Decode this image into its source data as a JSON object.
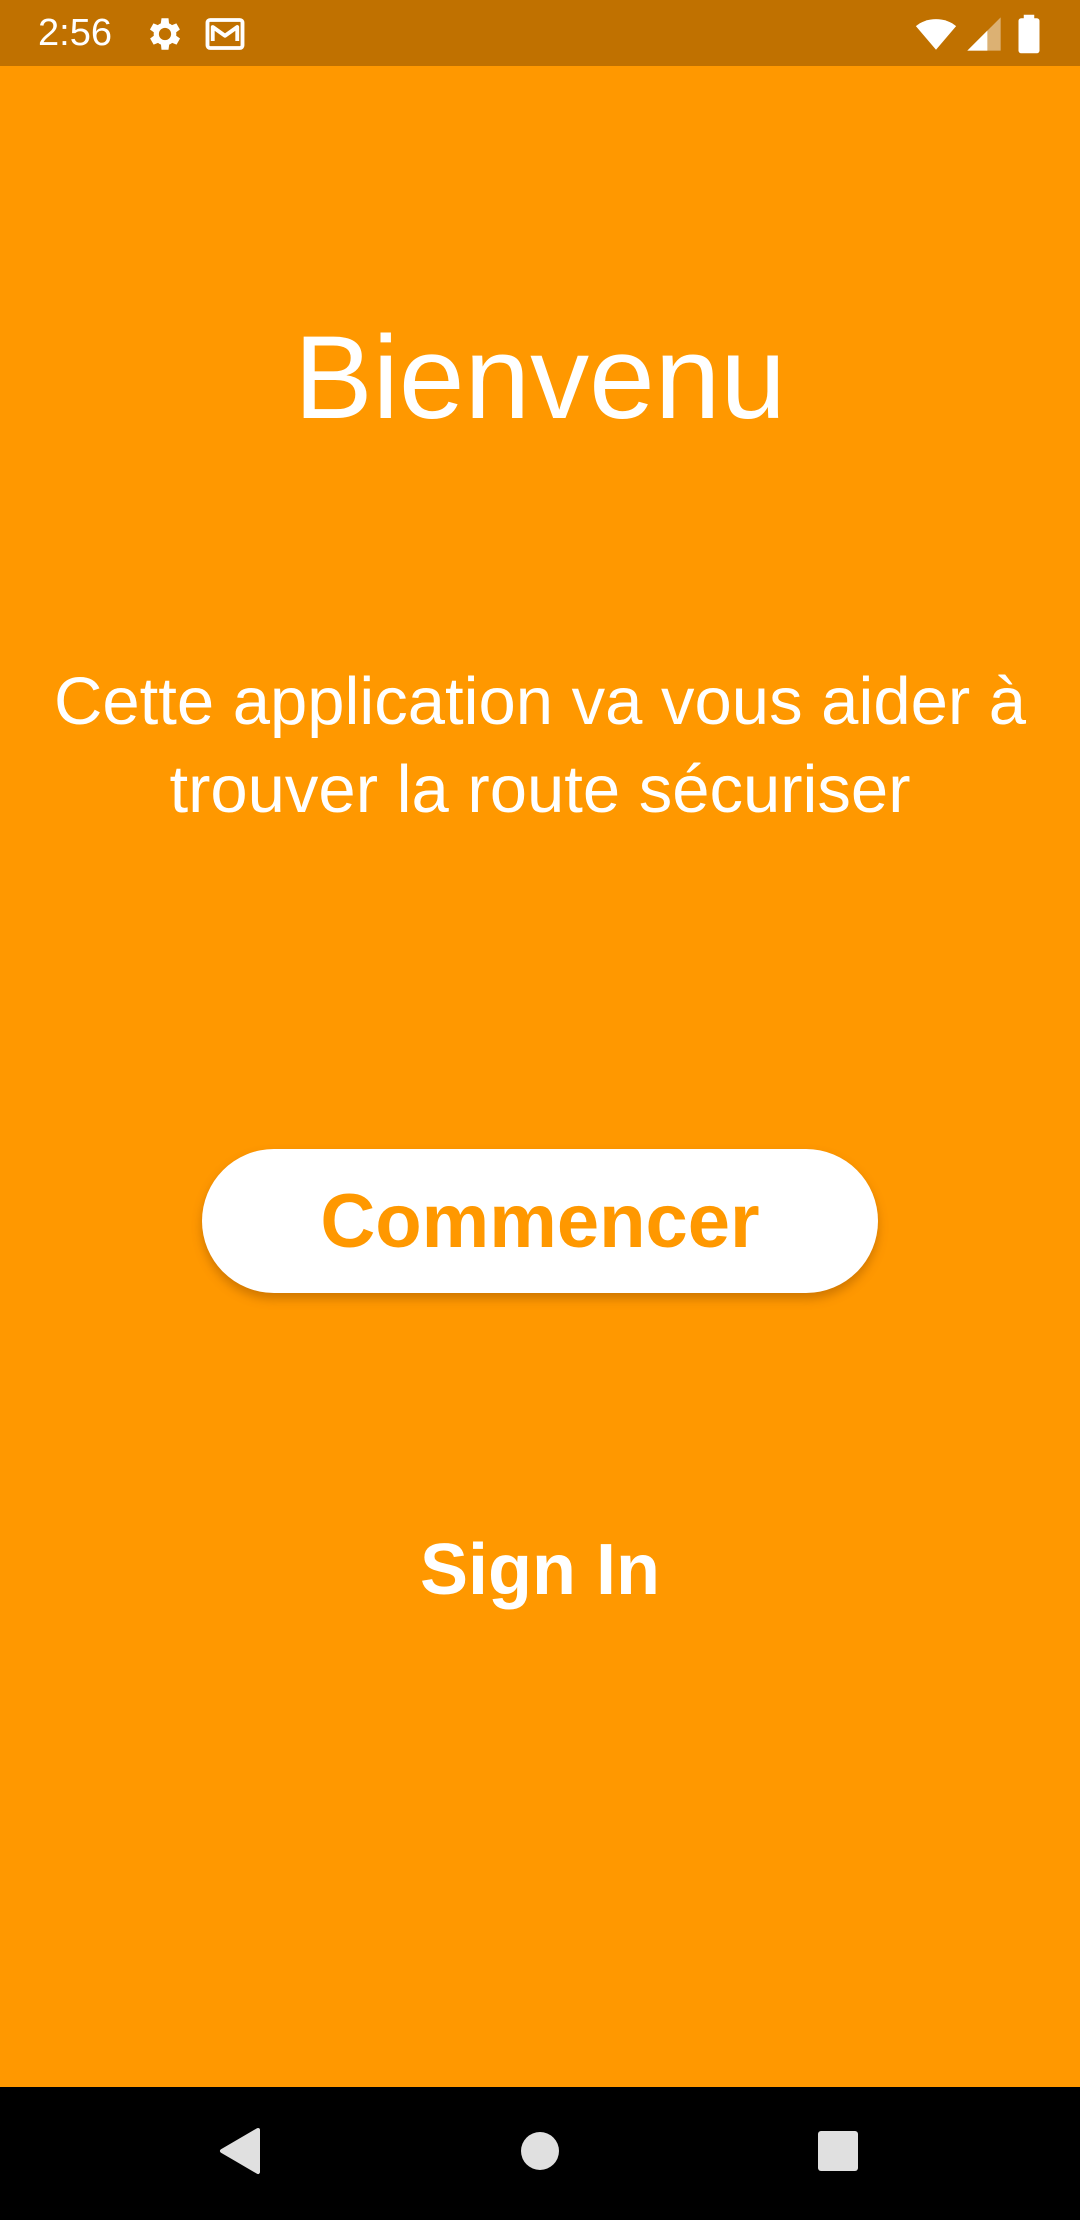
{
  "status_bar": {
    "time": "2:56",
    "left_icons": [
      "gear-icon",
      "mail-icon"
    ],
    "right_icons": [
      "wifi-icon",
      "signal-icon",
      "battery-icon"
    ]
  },
  "main": {
    "title": "Bienvenu",
    "subtitle": "Cette application va vous aider à trouver la route sécuriser",
    "start_button_label": "Commencer",
    "signin_label": "Sign In"
  },
  "nav_bar": {
    "buttons": [
      "back-icon",
      "home-icon",
      "recents-icon"
    ]
  },
  "colors": {
    "background": "#FF9800",
    "status_bar": "#C07100",
    "button_background": "#FFFFFF",
    "button_text": "#FF9800",
    "text": "#FFFFFF",
    "nav_bar": "#000000"
  }
}
